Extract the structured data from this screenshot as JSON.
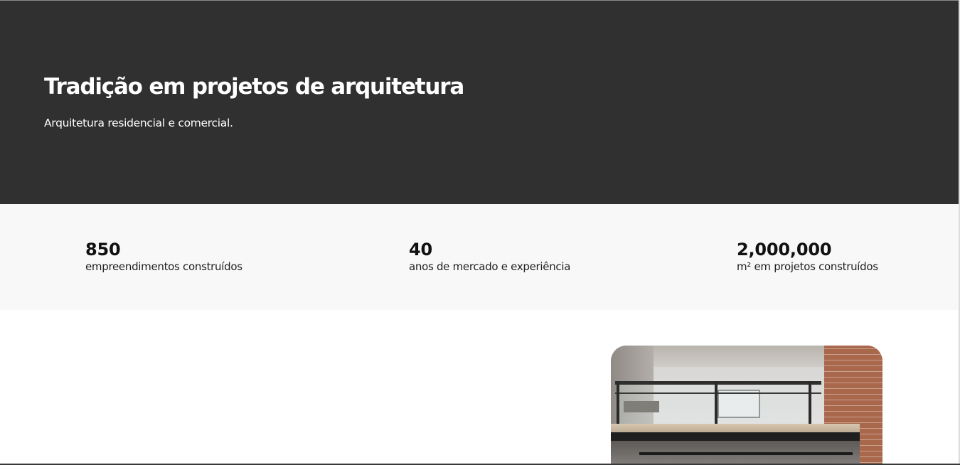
{
  "hero": {
    "title": "Tradição em projetos de arquitetura",
    "subtitle": "Arquitetura residencial e comercial."
  },
  "stats": [
    {
      "value": "850",
      "label": "empreendimentos construídos"
    },
    {
      "value": "40",
      "label": "anos de mercado e experiência"
    },
    {
      "value": "2,000,000",
      "label": "m² em projetos construídos"
    }
  ],
  "colors": {
    "hero_background": "#303030",
    "stats_background": "#f8f8f8",
    "text_light": "#ffffff",
    "text_dark": "#111111"
  }
}
